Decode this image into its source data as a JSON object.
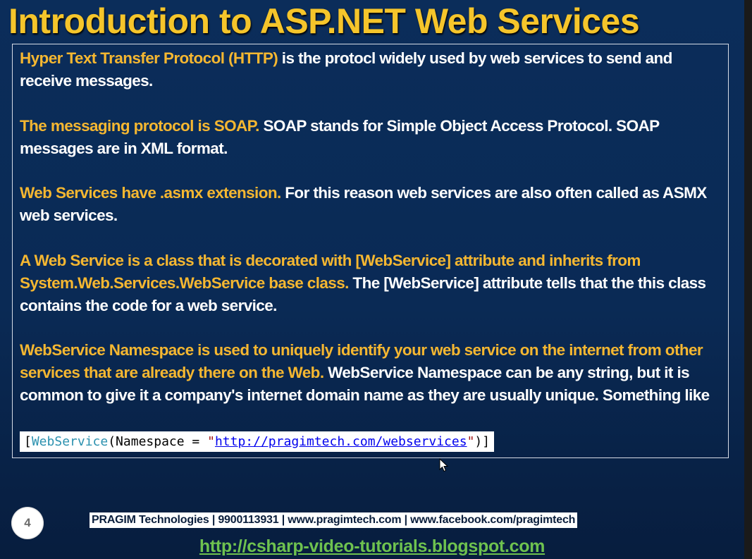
{
  "slide": {
    "title": "Introduction to ASP.NET Web Services",
    "paragraphs": [
      {
        "highlight": "Hyper Text Transfer Protocol (HTTP)",
        "text": " is the protocl widely used by web services to send and receive messages."
      },
      {
        "highlight": "The messaging protocol is SOAP.",
        "text": " SOAP stands for Simple Object Access Protocol. SOAP messages are in XML format."
      },
      {
        "highlight": "Web Services have .asmx extension.",
        "text": " For this reason web services are also often called as ASMX web services."
      },
      {
        "highlight": "A Web Service is a class that is decorated with [WebService] attribute and inherits from System.Web.Services.WebService base class.",
        "text": " The [WebService] attribute tells that the this class contains the code for a web service."
      },
      {
        "highlight": "WebService Namespace is used to uniquely identify your web service on the internet from other services that are already there on the Web.",
        "text": " WebService Namespace can be any string, but it is common to give it a company's internet domain name as they are usually unique. Something like"
      }
    ],
    "code": {
      "open": "[",
      "type": "WebService",
      "mid": "(Namespace = ",
      "quote_open": "\"",
      "url": "http://pragimtech.com/webservices",
      "quote_close": "\"",
      "close": ")]"
    },
    "page_number": "4",
    "footer": "PRAGIM Technologies | 9900113931 | www.pragimtech.com | www.facebook.com/pragimtech",
    "blog_link": "http://csharp-video-tutorials.blogspot.com"
  },
  "colors": {
    "title": "#f5c52b",
    "highlight": "#f5b731",
    "body_text": "#ffffff",
    "background": "#0b2d5a",
    "link_green": "#6ec24f"
  },
  "icons": {
    "cursor": "mouse-pointer-icon"
  }
}
